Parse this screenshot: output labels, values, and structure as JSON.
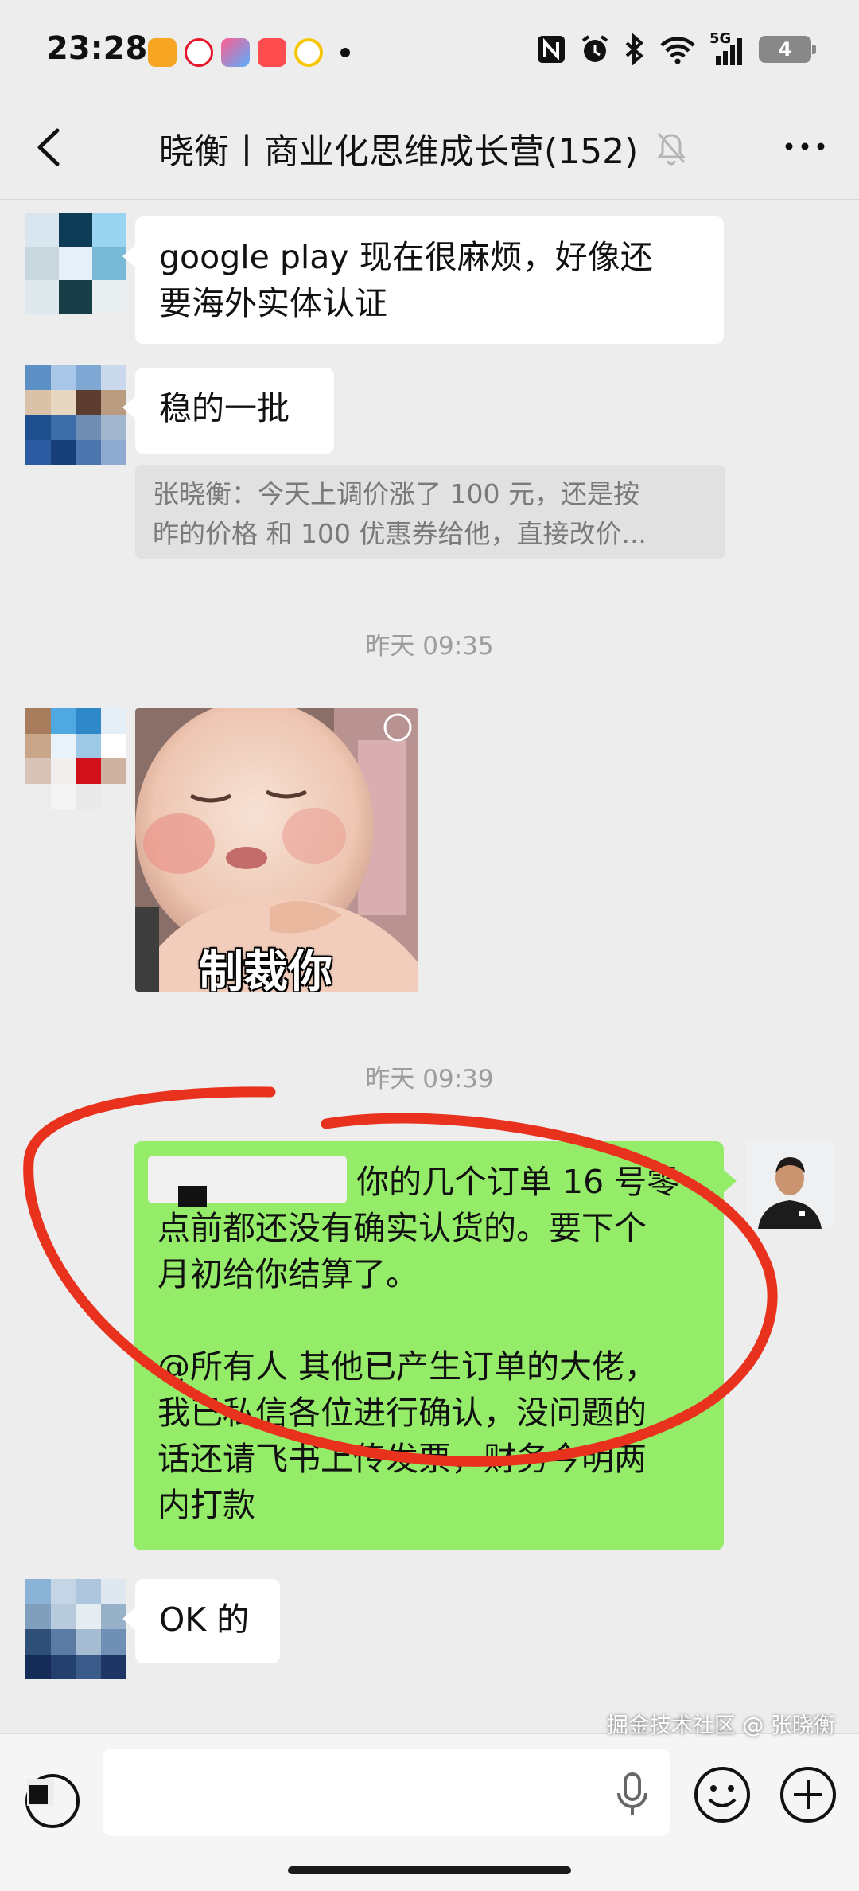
{
  "status_bar": {
    "time": "23:28",
    "network": "5G",
    "battery": "4",
    "icons": [
      "app-icon-1",
      "weibo-icon",
      "app-icon-3",
      "app-icon-4",
      "app-icon-5",
      "nfc-icon",
      "alarm-icon",
      "bluetooth-icon",
      "wifi-icon",
      "signal-icon",
      "battery-icon"
    ]
  },
  "header": {
    "title": "晓衡丨商业化思维成长营(152)",
    "back_icon": "chevron-left-icon",
    "mute_icon": "bell-off-icon",
    "more_icon": "more-icon"
  },
  "messages": [
    {
      "side": "left",
      "text_line1": "google play 现在很麻烦，好像还",
      "text_line2": "要海外实体认证"
    },
    {
      "side": "left",
      "text": "稳的一批",
      "quote_line1": "张晓衡：今天上调价涨了 100 元，还是按",
      "quote_line2": "昨的价格 和 100 优惠券给他，直接改价..."
    },
    {
      "type": "time",
      "text": "昨天 09:35"
    },
    {
      "side": "left",
      "type": "sticker",
      "caption": "制裁你"
    },
    {
      "type": "time",
      "text": "昨天 09:39"
    },
    {
      "side": "right",
      "line1": "你的几个订单 16 号零",
      "line2": "点前都还没有确实认货的。要下个",
      "line3": "月初给你结算了。",
      "line4": "@所有人  其他已产生订单的大佬，",
      "line5": "我已私信各位进行确认，没问题的",
      "line6": "话还请飞书上传发票，财务今明两",
      "line7": "内打款"
    },
    {
      "side": "left",
      "text": "OK 的"
    }
  ],
  "input_bar": {
    "placeholder": "",
    "watermark": "掘金技术社区 @ 张晓衡"
  },
  "colors": {
    "background": "#ededed",
    "bubble_self": "#95ec69",
    "bubble_other": "#ffffff",
    "annotation": "#e8321e"
  }
}
